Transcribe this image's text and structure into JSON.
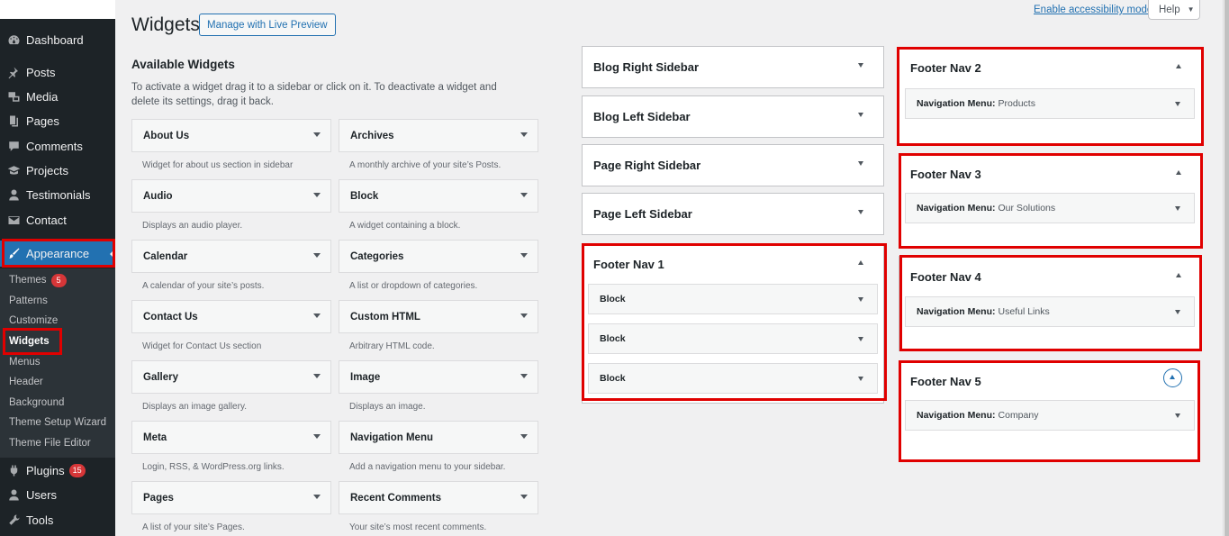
{
  "menu": {
    "dashboard": "Dashboard",
    "posts": "Posts",
    "media": "Media",
    "pages": "Pages",
    "comments": "Comments",
    "projects": "Projects",
    "testimonials": "Testimonials",
    "contact": "Contact",
    "appearance": "Appearance",
    "plugins": "Plugins",
    "plugins_badge": "15",
    "users": "Users",
    "tools": "Tools"
  },
  "submenu": {
    "themes": "Themes",
    "themes_badge": "5",
    "patterns": "Patterns",
    "customize": "Customize",
    "widgets": "Widgets",
    "menus": "Menus",
    "header": "Header",
    "background": "Background",
    "theme_setup_wizard": "Theme Setup Wizard",
    "theme_file_editor": "Theme File Editor"
  },
  "header": {
    "title": "Widgets",
    "live_preview_label": "Manage with Live Preview",
    "accessibility_link": "Enable accessibility mode",
    "help_label": "Help"
  },
  "available": {
    "title": "Available Widgets",
    "description": "To activate a widget drag it to a sidebar or click on it. To deactivate a widget and delete its settings, drag it back.",
    "widgets": [
      {
        "name": "About Us",
        "desc": "Widget for about us section in sidebar"
      },
      {
        "name": "Archives",
        "desc": "A monthly archive of your site’s Posts."
      },
      {
        "name": "Audio",
        "desc": "Displays an audio player."
      },
      {
        "name": "Block",
        "desc": "A widget containing a block."
      },
      {
        "name": "Calendar",
        "desc": "A calendar of your site’s posts."
      },
      {
        "name": "Categories",
        "desc": "A list or dropdown of categories."
      },
      {
        "name": "Contact Us",
        "desc": "Widget for Contact Us section"
      },
      {
        "name": "Custom HTML",
        "desc": "Arbitrary HTML code."
      },
      {
        "name": "Gallery",
        "desc": "Displays an image gallery."
      },
      {
        "name": "Image",
        "desc": "Displays an image."
      },
      {
        "name": "Meta",
        "desc": "Login, RSS, & WordPress.org links."
      },
      {
        "name": "Navigation Menu",
        "desc": "Add a navigation menu to your sidebar."
      },
      {
        "name": "Pages",
        "desc": "A list of your site’s Pages."
      },
      {
        "name": "Recent Comments",
        "desc": "Your site’s most recent comments."
      }
    ]
  },
  "sidebars_col1": {
    "blog_right": "Blog Right Sidebar",
    "blog_left": "Blog Left Sidebar",
    "page_right": "Page Right Sidebar",
    "page_left": "Page Left Sidebar",
    "footer_nav_1": "Footer Nav 1",
    "footer_nav_1_widgets": [
      "Block",
      "Block",
      "Block"
    ]
  },
  "sidebars_col2": {
    "footer_nav_2": "Footer Nav 2",
    "footer_nav_2_widget": "Navigation Menu:",
    "footer_nav_2_sub": "Products",
    "footer_nav_3": "Footer Nav 3",
    "footer_nav_3_widget": "Navigation Menu:",
    "footer_nav_3_sub": "Our Solutions",
    "footer_nav_4": "Footer Nav 4",
    "footer_nav_4_widget": "Navigation Menu:",
    "footer_nav_4_sub": "Useful Links",
    "footer_nav_5": "Footer Nav 5",
    "footer_nav_5_widget": "Navigation Menu:",
    "footer_nav_5_sub": "Company"
  },
  "colors": {
    "highlight": "#e00000",
    "admin_menu_bg": "#1d2327",
    "accent": "#2271b1"
  }
}
